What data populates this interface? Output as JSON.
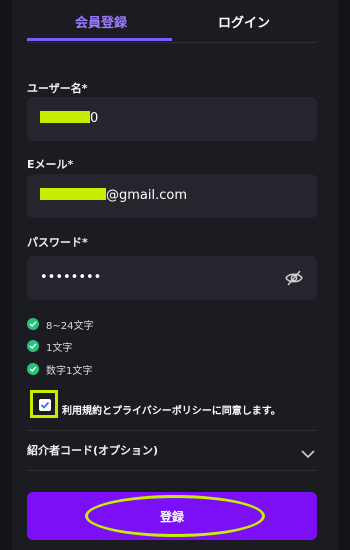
{
  "tabs": {
    "signup": "会員登録",
    "login": "ログイン"
  },
  "form": {
    "username": {
      "label": "ユーザー名*",
      "value_suffix": "0"
    },
    "email": {
      "label": "Eメール*",
      "value_suffix": "@gmail.com"
    },
    "password": {
      "label": "パスワード*",
      "value": "••••••••"
    }
  },
  "password_rules": [
    "8~24文字",
    "1文字",
    "数字1文字"
  ],
  "consent": {
    "checked": true,
    "text": "利用規約とプライバシーポリシーに同意します。"
  },
  "referral": {
    "label": "紹介者コード(オプション)"
  },
  "submit": {
    "label": "登録"
  },
  "colors": {
    "accent": "#7c5cff",
    "button": "#7b10f7",
    "highlight": "#c6ef00",
    "success": "#27c17a",
    "panel": "#1b1b22",
    "field": "#25252d"
  },
  "icons": {
    "password_toggle": "eye-off-icon",
    "rule": "check-circle-icon",
    "consent": "checkbox-checked-icon",
    "referral": "chevron-down-icon"
  }
}
